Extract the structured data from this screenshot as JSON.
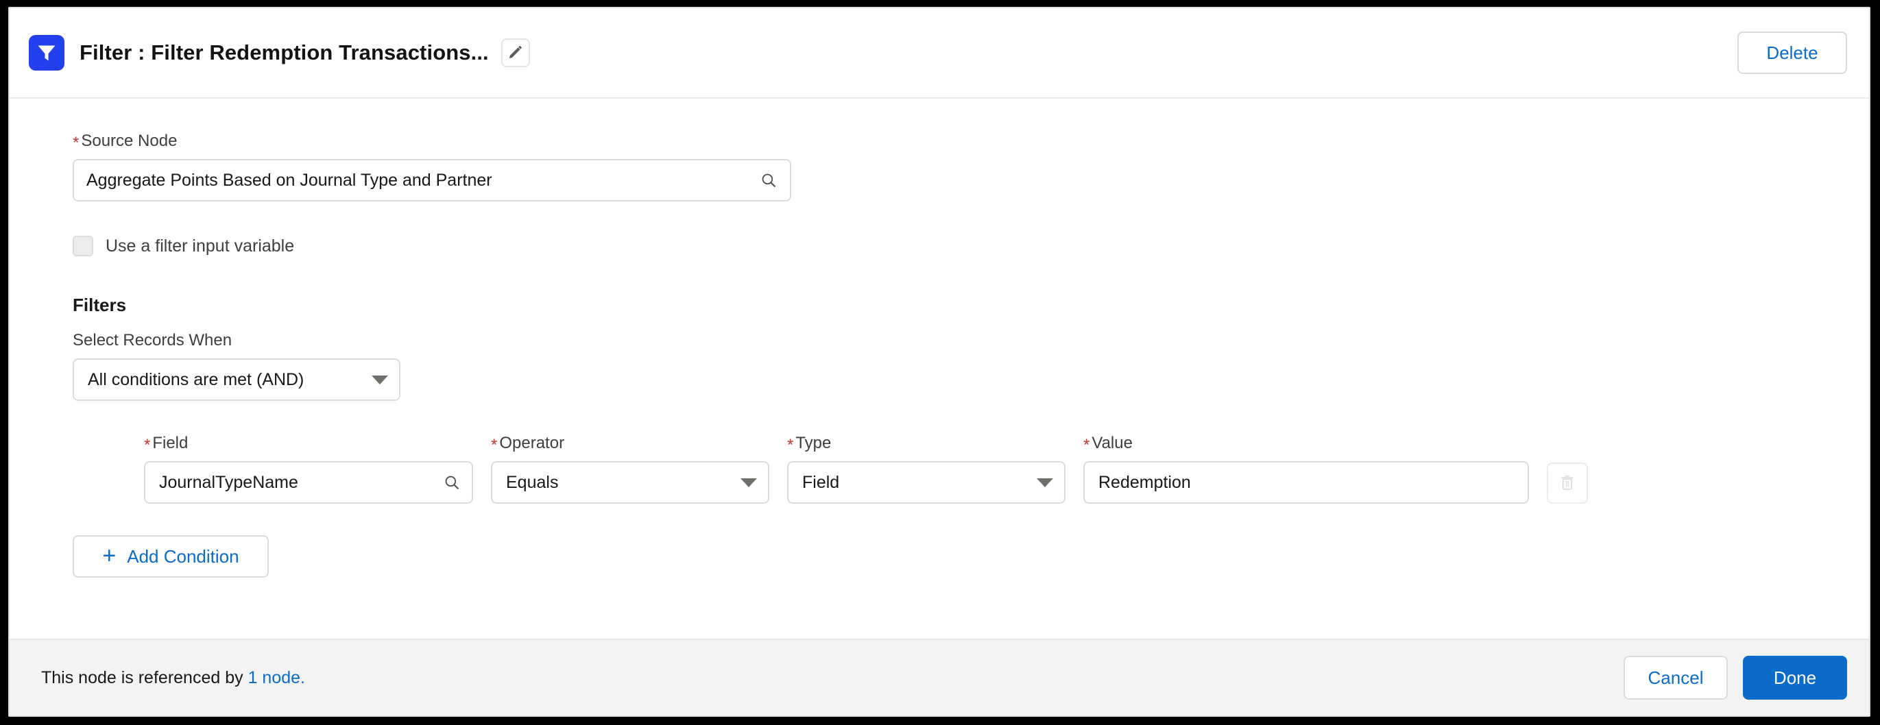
{
  "header": {
    "icon": "filter-icon",
    "title": "Filter :  Filter Redemption Transactions...",
    "edit_icon": "pencil-icon",
    "delete_label": "Delete"
  },
  "form": {
    "source_node": {
      "label": "Source Node",
      "required_marker": "*",
      "value": "Aggregate Points Based on Journal Type and Partner",
      "icon": "search-icon"
    },
    "filter_input_variable": {
      "label": "Use a filter input variable",
      "checked": false
    },
    "filters_heading": "Filters",
    "select_records_when": {
      "label": "Select Records When",
      "value": "All conditions are met (AND)",
      "icon": "chevron-down-icon"
    },
    "condition_labels": {
      "field": "Field",
      "operator": "Operator",
      "type": "Type",
      "value": "Value",
      "required_marker": "*"
    },
    "conditions": [
      {
        "field": "JournalTypeName",
        "field_icon": "search-icon",
        "operator": "Equals",
        "type": "Field",
        "value": "Redemption",
        "delete_icon": "trash-icon"
      }
    ],
    "add_condition": {
      "label": "Add Condition",
      "icon": "plus-icon"
    }
  },
  "footer": {
    "note_prefix": "This node is referenced by ",
    "note_link": "1 node.",
    "cancel_label": "Cancel",
    "done_label": "Done"
  },
  "colors": {
    "brand_blue": "#0b6bcb",
    "icon_blue": "#2440ee",
    "required_red": "#c23934",
    "footer_bg": "#f3f3f3",
    "border": "#dddbda"
  }
}
